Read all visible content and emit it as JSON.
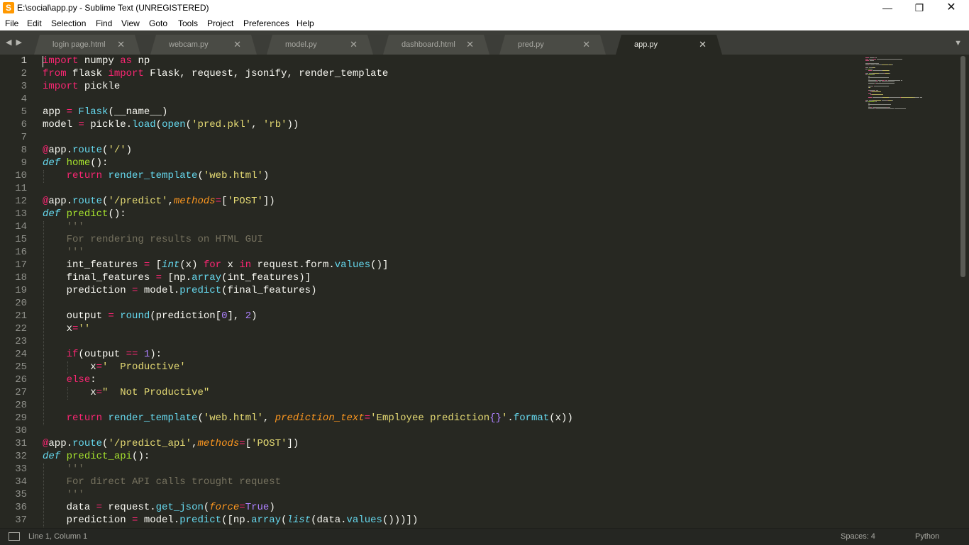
{
  "window": {
    "title": "E:\\social\\app.py - Sublime Text (UNREGISTERED)",
    "app_icon_letter": "S",
    "minimize": "—",
    "maximize": "❐",
    "close": "✕"
  },
  "menu": [
    "File",
    "Edit",
    "Selection",
    "Find",
    "View",
    "Goto",
    "Tools",
    "Project",
    "Preferences",
    "Help"
  ],
  "tabs": [
    {
      "label": "login page.html",
      "active": false
    },
    {
      "label": "webcam.py",
      "active": false
    },
    {
      "label": "model.py",
      "active": false
    },
    {
      "label": "dashboard.html",
      "active": false
    },
    {
      "label": "pred.py",
      "active": false
    },
    {
      "label": "app.py",
      "active": true
    }
  ],
  "tab_close_glyph": "✕",
  "nav_arrows": "◀▶",
  "tab_menu_glyph": "▼",
  "editor": {
    "current_line": 1,
    "colors": {
      "background": "#272822",
      "keyword": "#f92672",
      "function": "#a6e22e",
      "builtin": "#66d9ef",
      "string": "#e6db74",
      "number": "#ae81ff",
      "parameter": "#fd971f",
      "comment": "#75715e"
    },
    "lines": [
      {
        "n": "1",
        "tokens": [
          [
            "kw",
            "import"
          ],
          [
            "t",
            " numpy "
          ],
          [
            "kw",
            "as"
          ],
          [
            "t",
            " np"
          ]
        ]
      },
      {
        "n": "2",
        "tokens": [
          [
            "kw",
            "from"
          ],
          [
            "t",
            " flask "
          ],
          [
            "kw",
            "import"
          ],
          [
            "t",
            " Flask, request, jsonify, render_template"
          ]
        ]
      },
      {
        "n": "3",
        "tokens": [
          [
            "kw",
            "import"
          ],
          [
            "t",
            " pickle"
          ]
        ]
      },
      {
        "n": "4",
        "tokens": []
      },
      {
        "n": "5",
        "tokens": [
          [
            "t",
            "app "
          ],
          [
            "kw",
            "="
          ],
          [
            "t",
            " "
          ],
          [
            "bi",
            "Flask"
          ],
          [
            "t",
            "(__name__)"
          ]
        ]
      },
      {
        "n": "6",
        "tokens": [
          [
            "t",
            "model "
          ],
          [
            "kw",
            "="
          ],
          [
            "t",
            " pickle."
          ],
          [
            "bi",
            "load"
          ],
          [
            "t",
            "("
          ],
          [
            "bi",
            "open"
          ],
          [
            "t",
            "("
          ],
          [
            "str",
            "'pred.pkl'"
          ],
          [
            "t",
            ", "
          ],
          [
            "str",
            "'rb'"
          ],
          [
            "t",
            "))"
          ]
        ]
      },
      {
        "n": "7",
        "tokens": []
      },
      {
        "n": "8",
        "tokens": [
          [
            "kw",
            "@"
          ],
          [
            "t",
            "app."
          ],
          [
            "bi",
            "route"
          ],
          [
            "t",
            "("
          ],
          [
            "str",
            "'/'"
          ],
          [
            "t",
            ")"
          ]
        ]
      },
      {
        "n": "9",
        "tokens": [
          [
            "dk",
            "def"
          ],
          [
            "t",
            " "
          ],
          [
            "fn",
            "home"
          ],
          [
            "t",
            "():"
          ]
        ]
      },
      {
        "n": "10",
        "tokens": [
          [
            "t",
            "    "
          ],
          [
            "kw",
            "return"
          ],
          [
            "t",
            " "
          ],
          [
            "bi",
            "render_template"
          ],
          [
            "t",
            "("
          ],
          [
            "str",
            "'web.html'"
          ],
          [
            "t",
            ")"
          ]
        ]
      },
      {
        "n": "11",
        "tokens": []
      },
      {
        "n": "12",
        "tokens": [
          [
            "kw",
            "@"
          ],
          [
            "t",
            "app."
          ],
          [
            "bi",
            "route"
          ],
          [
            "t",
            "("
          ],
          [
            "str",
            "'/predict'"
          ],
          [
            "t",
            ","
          ],
          [
            "param",
            "methods"
          ],
          [
            "kw",
            "="
          ],
          [
            "t",
            "["
          ],
          [
            "str",
            "'POST'"
          ],
          [
            "t",
            "])"
          ]
        ]
      },
      {
        "n": "13",
        "tokens": [
          [
            "dk",
            "def"
          ],
          [
            "t",
            " "
          ],
          [
            "fn",
            "predict"
          ],
          [
            "t",
            "():"
          ]
        ]
      },
      {
        "n": "14",
        "tokens": [
          [
            "t",
            "    "
          ],
          [
            "cm",
            "'''"
          ]
        ]
      },
      {
        "n": "15",
        "tokens": [
          [
            "t",
            "    "
          ],
          [
            "cm",
            "For rendering results on HTML GUI"
          ]
        ]
      },
      {
        "n": "16",
        "tokens": [
          [
            "t",
            "    "
          ],
          [
            "cm",
            "'''"
          ]
        ]
      },
      {
        "n": "17",
        "tokens": [
          [
            "t",
            "    int_features "
          ],
          [
            "kw",
            "="
          ],
          [
            "t",
            " ["
          ],
          [
            "dk",
            "int"
          ],
          [
            "t",
            "(x) "
          ],
          [
            "kw",
            "for"
          ],
          [
            "t",
            " x "
          ],
          [
            "kw",
            "in"
          ],
          [
            "t",
            " request.form."
          ],
          [
            "bi",
            "values"
          ],
          [
            "t",
            "()]"
          ]
        ]
      },
      {
        "n": "18",
        "tokens": [
          [
            "t",
            "    final_features "
          ],
          [
            "kw",
            "="
          ],
          [
            "t",
            " [np."
          ],
          [
            "bi",
            "array"
          ],
          [
            "t",
            "(int_features)]"
          ]
        ]
      },
      {
        "n": "19",
        "tokens": [
          [
            "t",
            "    prediction "
          ],
          [
            "kw",
            "="
          ],
          [
            "t",
            " model."
          ],
          [
            "bi",
            "predict"
          ],
          [
            "t",
            "(final_features)"
          ]
        ]
      },
      {
        "n": "20",
        "tokens": []
      },
      {
        "n": "21",
        "tokens": [
          [
            "t",
            "    output "
          ],
          [
            "kw",
            "="
          ],
          [
            "t",
            " "
          ],
          [
            "bi",
            "round"
          ],
          [
            "t",
            "(prediction["
          ],
          [
            "num",
            "0"
          ],
          [
            "t",
            "], "
          ],
          [
            "num",
            "2"
          ],
          [
            "t",
            ")"
          ]
        ]
      },
      {
        "n": "22",
        "tokens": [
          [
            "t",
            "    x"
          ],
          [
            "kw",
            "="
          ],
          [
            "str",
            "''"
          ]
        ]
      },
      {
        "n": "23",
        "tokens": []
      },
      {
        "n": "24",
        "tokens": [
          [
            "t",
            "    "
          ],
          [
            "kw",
            "if"
          ],
          [
            "t",
            "(output "
          ],
          [
            "kw",
            "=="
          ],
          [
            "t",
            " "
          ],
          [
            "num",
            "1"
          ],
          [
            "t",
            "):"
          ]
        ]
      },
      {
        "n": "25",
        "tokens": [
          [
            "t",
            "        x"
          ],
          [
            "kw",
            "="
          ],
          [
            "str",
            "'  Productive'"
          ]
        ]
      },
      {
        "n": "26",
        "tokens": [
          [
            "t",
            "    "
          ],
          [
            "kw",
            "else"
          ],
          [
            "t",
            ":"
          ]
        ]
      },
      {
        "n": "27",
        "tokens": [
          [
            "t",
            "        x"
          ],
          [
            "kw",
            "="
          ],
          [
            "str",
            "\"  Not Productive\""
          ]
        ]
      },
      {
        "n": "28",
        "tokens": []
      },
      {
        "n": "29",
        "tokens": [
          [
            "t",
            "    "
          ],
          [
            "kw",
            "return"
          ],
          [
            "t",
            " "
          ],
          [
            "bi",
            "render_template"
          ],
          [
            "t",
            "("
          ],
          [
            "str",
            "'web.html'"
          ],
          [
            "t",
            ", "
          ],
          [
            "param",
            "prediction_text"
          ],
          [
            "kw",
            "="
          ],
          [
            "str",
            "'Employee prediction"
          ],
          [
            "num",
            "{}"
          ],
          [
            "str",
            "'"
          ],
          [
            "t",
            "."
          ],
          [
            "bi",
            "format"
          ],
          [
            "t",
            "(x))"
          ]
        ]
      },
      {
        "n": "30",
        "tokens": []
      },
      {
        "n": "31",
        "tokens": [
          [
            "kw",
            "@"
          ],
          [
            "t",
            "app."
          ],
          [
            "bi",
            "route"
          ],
          [
            "t",
            "("
          ],
          [
            "str",
            "'/predict_api'"
          ],
          [
            "t",
            ","
          ],
          [
            "param",
            "methods"
          ],
          [
            "kw",
            "="
          ],
          [
            "t",
            "["
          ],
          [
            "str",
            "'POST'"
          ],
          [
            "t",
            "])"
          ]
        ]
      },
      {
        "n": "32",
        "tokens": [
          [
            "dk",
            "def"
          ],
          [
            "t",
            " "
          ],
          [
            "fn",
            "predict_api"
          ],
          [
            "t",
            "():"
          ]
        ]
      },
      {
        "n": "33",
        "tokens": [
          [
            "t",
            "    "
          ],
          [
            "cm",
            "'''"
          ]
        ]
      },
      {
        "n": "34",
        "tokens": [
          [
            "t",
            "    "
          ],
          [
            "cm",
            "For direct API calls trought request"
          ]
        ]
      },
      {
        "n": "35",
        "tokens": [
          [
            "t",
            "    "
          ],
          [
            "cm",
            "'''"
          ]
        ]
      },
      {
        "n": "36",
        "tokens": [
          [
            "t",
            "    data "
          ],
          [
            "kw",
            "="
          ],
          [
            "t",
            " request."
          ],
          [
            "bi",
            "get_json"
          ],
          [
            "t",
            "("
          ],
          [
            "param",
            "force"
          ],
          [
            "kw",
            "="
          ],
          [
            "num",
            "True"
          ],
          [
            "t",
            ")"
          ]
        ]
      },
      {
        "n": "37",
        "tokens": [
          [
            "t",
            "    prediction "
          ],
          [
            "kw",
            "="
          ],
          [
            "t",
            " model."
          ],
          [
            "bi",
            "predict"
          ],
          [
            "t",
            "([np."
          ],
          [
            "bi",
            "array"
          ],
          [
            "t",
            "("
          ],
          [
            "dk",
            "list"
          ],
          [
            "t",
            "(data."
          ],
          [
            "bi",
            "values"
          ],
          [
            "t",
            "()))])"
          ]
        ]
      }
    ]
  },
  "status": {
    "position": "Line 1, Column 1",
    "indent": "Spaces: 4",
    "syntax": "Python"
  }
}
